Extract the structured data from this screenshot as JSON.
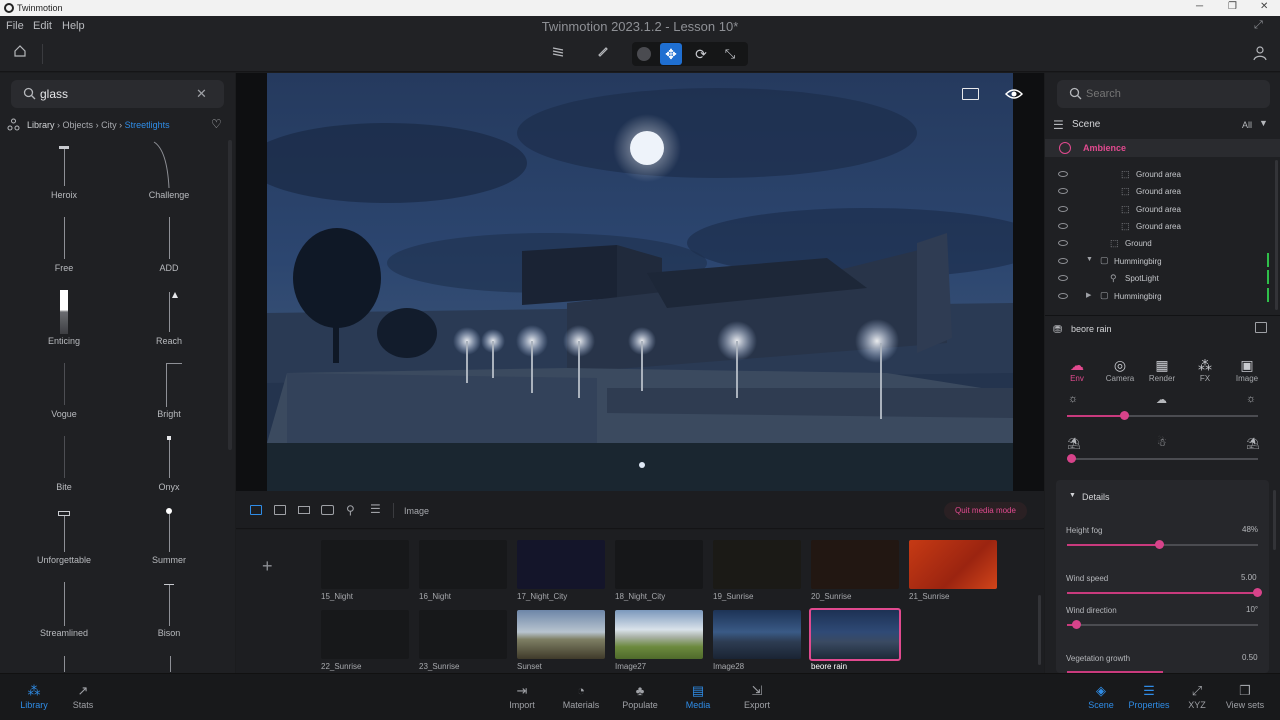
{
  "window": {
    "app_name": "Twinmotion",
    "title": "Twinmotion 2023.1.2 - Lesson 10*",
    "minimize": "─",
    "restore": "❐",
    "close": "✕"
  },
  "menu": [
    "File",
    "Edit",
    "Help"
  ],
  "toolbar": {
    "icons": [
      "layers-icon",
      "pen-icon",
      "circle-icon",
      "move-icon",
      "rotate-icon",
      "scale-icon"
    ]
  },
  "library": {
    "search_value": "glass",
    "breadcrumb": [
      "Library",
      "Objects",
      "City",
      "Streetlights"
    ],
    "separator": "›",
    "items": [
      "Heroix",
      "Challenge",
      "Free",
      "ADD",
      "Enticing",
      "Reach",
      "Vogue",
      "Bright",
      "Bite",
      "Onyx",
      "Unforgettable",
      "Summer",
      "Streamlined",
      "Bison"
    ]
  },
  "viewport": {
    "panel_icon": "viewport-panel-icon",
    "eye_icon": "eye-icon"
  },
  "media": {
    "mode_label": "Image",
    "quit_label": "Quit media mode",
    "add_label": "+",
    "thumbnails": [
      "15_Night",
      "16_Night",
      "17_Night_City",
      "18_Night_City",
      "19_Sunrise",
      "20_Sunrise",
      "21_Sunrise",
      "22_Sunrise",
      "23_Sunrise",
      "Sunset",
      "Image27",
      "Image28",
      "beore rain"
    ],
    "selected": "beore rain"
  },
  "scene": {
    "search_placeholder": "Search",
    "header": "Scene",
    "filter": "All",
    "ambience": "Ambience",
    "tree": [
      {
        "label": "Ground area",
        "indent": 3
      },
      {
        "label": "Ground area",
        "indent": 3
      },
      {
        "label": "Ground area",
        "indent": 3
      },
      {
        "label": "Ground area",
        "indent": 3
      },
      {
        "label": "Ground",
        "indent": 2
      },
      {
        "label": "Hummingbirg",
        "indent": 1
      },
      {
        "label": "SpotLight",
        "indent": 2
      },
      {
        "label": "Hummingbirg",
        "indent": 1
      }
    ]
  },
  "properties": {
    "item_name": "beore rain",
    "tabs": [
      "Env",
      "Camera",
      "Render",
      "FX",
      "Image"
    ],
    "active_tab": "Env",
    "sun_slider": 0.3,
    "temp_slider": 0.0,
    "details_label": "Details",
    "details": [
      {
        "label": "Height fog",
        "value": "48%",
        "fraction": 0.48
      },
      {
        "label": "Wind speed",
        "value": "5.00",
        "fraction": 1.0
      },
      {
        "label": "Wind direction",
        "value": "10°",
        "fraction": 0.03
      },
      {
        "label": "Vegetation growth",
        "value": "0.50",
        "fraction": 0.5
      }
    ]
  },
  "bottom": {
    "left": [
      "Library",
      "Stats"
    ],
    "center": [
      "Import",
      "Materials",
      "Populate",
      "Media",
      "Export"
    ],
    "right": [
      "Scene",
      "Properties",
      "XYZ",
      "View sets"
    ],
    "active_left": "Library",
    "active_center": "Media",
    "active_right": [
      "Scene",
      "Properties"
    ]
  },
  "colors": {
    "accent_pink": "#e14a8f",
    "accent_blue": "#2f8ce6",
    "slider_pink": "#c93a7d"
  }
}
